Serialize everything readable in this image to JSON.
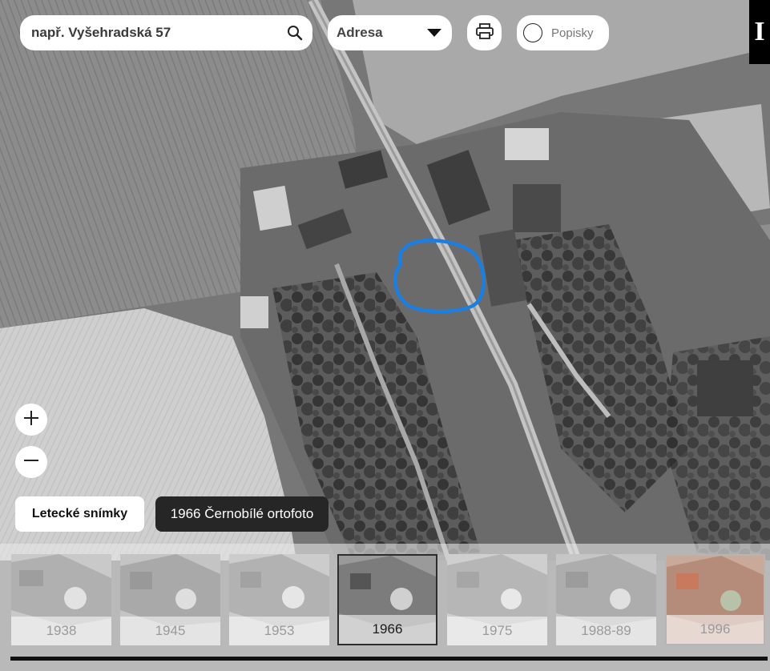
{
  "search": {
    "placeholder": "např. Vyšehradská 57",
    "icon": "search-icon"
  },
  "search_type": {
    "selected": "Adresa",
    "icon": "caret-down-icon"
  },
  "print": {
    "icon": "printer-icon"
  },
  "labels_toggle": {
    "label": "Popisky",
    "checked": false
  },
  "corner_button": {
    "label": "I"
  },
  "zoom": {
    "in_icon": "plus-icon",
    "out_icon": "minus-icon"
  },
  "layer": {
    "button_label": "Letecké snímky",
    "current": "1966 Černobílé ortofoto"
  },
  "timeline": {
    "years": [
      "1938",
      "1945",
      "1953",
      "1966",
      "1975",
      "1988-89",
      "1996"
    ],
    "selected": "1966"
  },
  "highlight": {
    "color": "#1a7fe0"
  }
}
